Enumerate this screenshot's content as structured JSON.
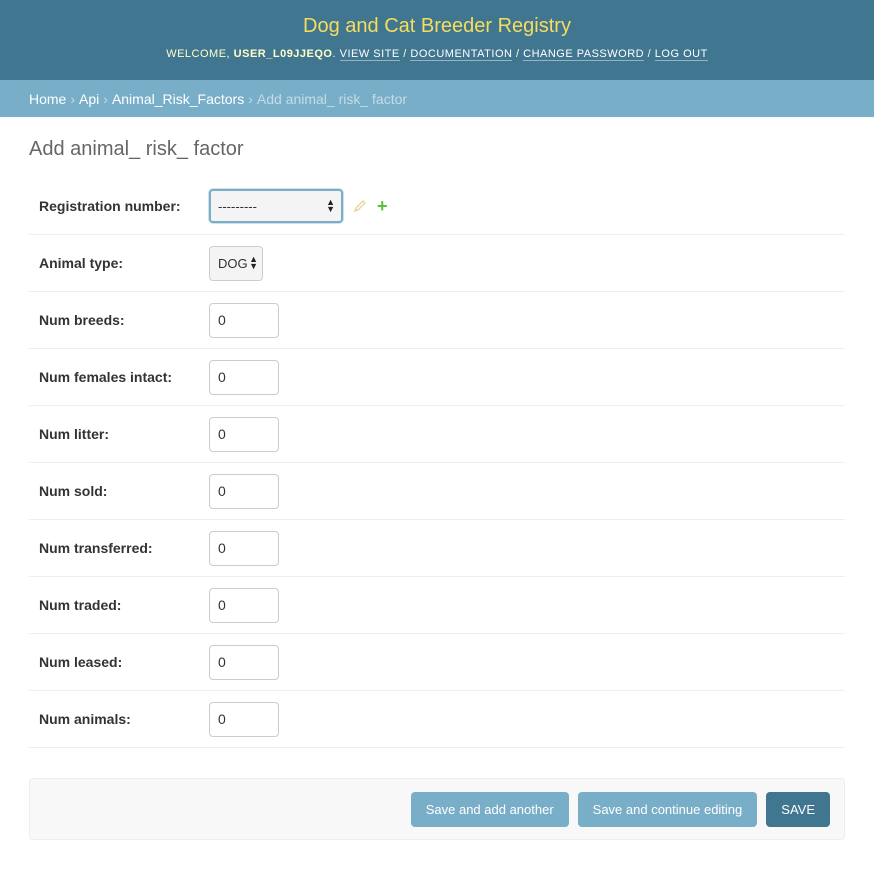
{
  "header": {
    "site_title": "Dog and Cat Breeder Registry",
    "welcome": "Welcome,",
    "username": "USER_L09JJEQO",
    "links": [
      "View site",
      "Documentation",
      "Change password",
      "Log out"
    ]
  },
  "breadcrumbs": {
    "items": [
      "Home",
      "Api",
      "Animal_Risk_Factors"
    ],
    "current": "Add animal_ risk_ factor"
  },
  "page_title": "Add animal_ risk_ factor",
  "form": {
    "registration_number": {
      "label": "Registration number:",
      "value": "---------"
    },
    "animal_type": {
      "label": "Animal type:",
      "value": "DOG"
    },
    "num_fields": [
      {
        "label": "Num breeds:",
        "value": "0"
      },
      {
        "label": "Num females intact:",
        "value": "0"
      },
      {
        "label": "Num litter:",
        "value": "0"
      },
      {
        "label": "Num sold:",
        "value": "0"
      },
      {
        "label": "Num transferred:",
        "value": "0"
      },
      {
        "label": "Num traded:",
        "value": "0"
      },
      {
        "label": "Num leased:",
        "value": "0"
      },
      {
        "label": "Num animals:",
        "value": "0"
      }
    ]
  },
  "actions": {
    "save_add_another": "Save and add another",
    "save_continue": "Save and continue editing",
    "save": "Save"
  },
  "icons": {
    "edit": "pencil-icon",
    "add": "plus-icon"
  },
  "colors": {
    "header": "#417690",
    "breadcrumbs": "#79aec8",
    "title": "#f5dd5d",
    "add_green": "#5fbd3f"
  }
}
